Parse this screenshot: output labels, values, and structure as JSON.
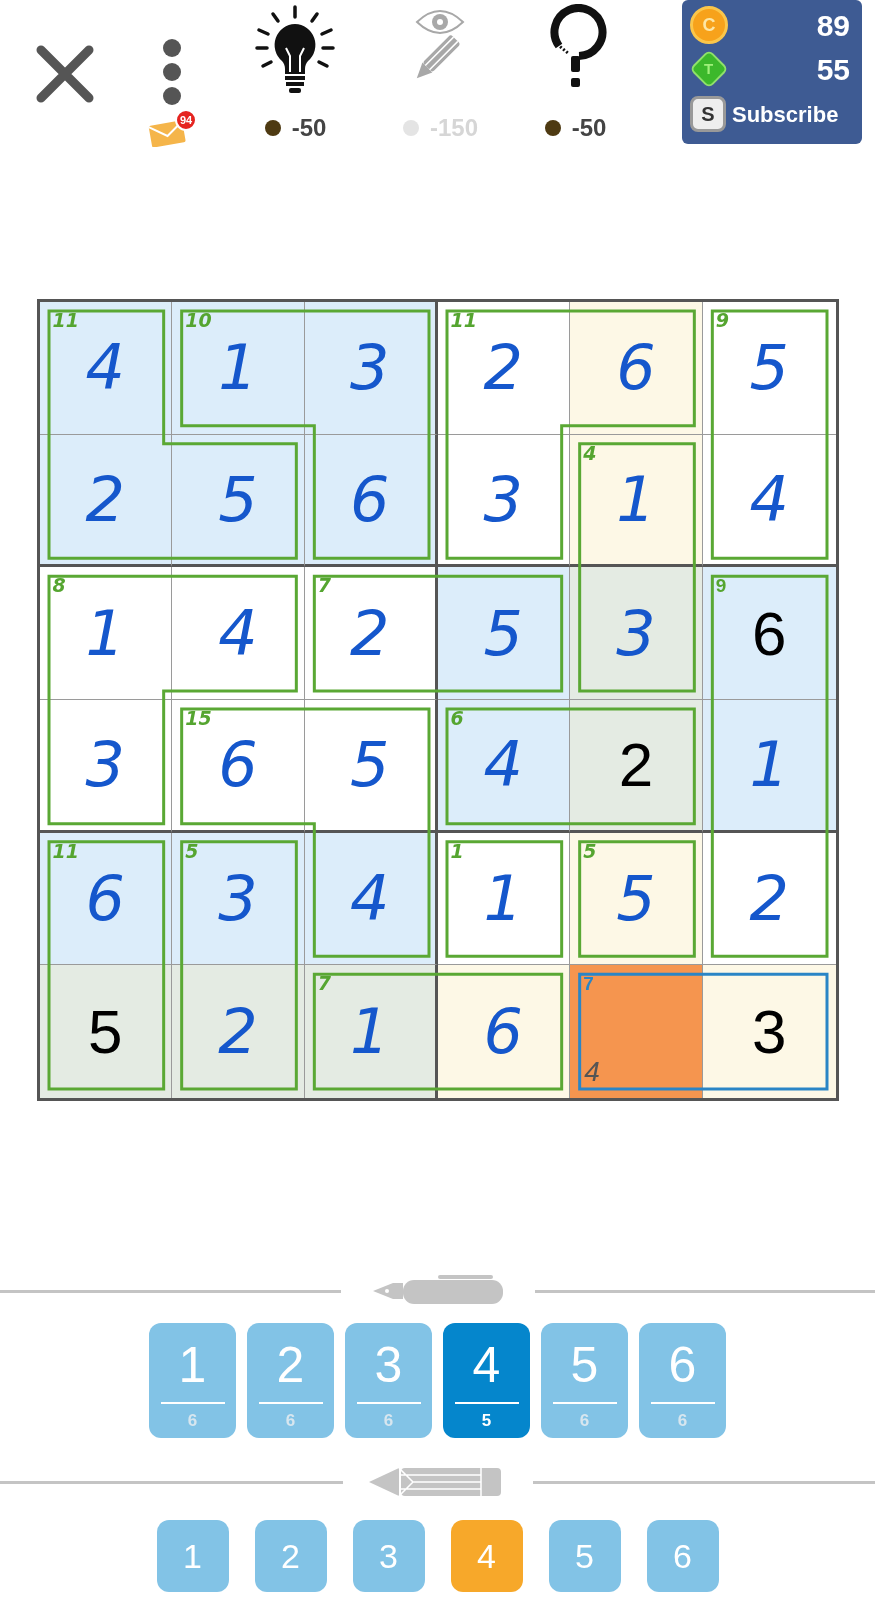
{
  "header": {
    "close": true,
    "menu": {
      "mail_badge": "94"
    }
  },
  "tools": [
    {
      "kind": "hint",
      "cost": "-50",
      "disabled": false
    },
    {
      "kind": "reveal",
      "cost": "-150",
      "disabled": true
    },
    {
      "kind": "check",
      "cost": "-50",
      "disabled": false
    }
  ],
  "wallet": {
    "coins": {
      "letter": "C",
      "amount": "89"
    },
    "tokens": {
      "letter": "T",
      "amount": "55"
    },
    "subscribe": {
      "letter": "S",
      "label": "Subscribe"
    }
  },
  "grid": {
    "rows": [
      {
        "cells": [
          {
            "value": "4",
            "given": false,
            "color": "#dcedfa",
            "cage_sum": "11",
            "join_right": false,
            "join_down": true,
            "selected": false
          },
          {
            "value": "1",
            "given": false,
            "color": "#dcedfa",
            "cage_sum": "10",
            "join_right": true,
            "join_down": false,
            "selected": false
          },
          {
            "value": "3",
            "given": false,
            "color": "#dcedfa",
            "join_right": false,
            "join_down": true,
            "selected": false
          },
          {
            "value": "2",
            "given": false,
            "color": "#ffffff",
            "cage_sum": "11",
            "join_right": true,
            "join_down": true,
            "selected": false
          },
          {
            "value": "6",
            "given": false,
            "color": "#fdf8e6",
            "join_right": false,
            "join_down": false,
            "selected": false
          },
          {
            "value": "5",
            "given": false,
            "color": "#ffffff",
            "cage_sum": "9",
            "join_right": false,
            "join_down": true,
            "selected": false
          }
        ]
      },
      {
        "cells": [
          {
            "value": "2",
            "given": false,
            "color": "#dcedfa",
            "join_right": true,
            "join_down": false,
            "selected": false
          },
          {
            "value": "5",
            "given": false,
            "color": "#dcedfa",
            "join_right": false,
            "join_down": false,
            "selected": false
          },
          {
            "value": "6",
            "given": false,
            "color": "#dcedfa",
            "join_right": false,
            "join_down": false,
            "selected": false
          },
          {
            "value": "3",
            "given": false,
            "color": "#ffffff",
            "join_right": false,
            "join_down": false,
            "selected": false
          },
          {
            "value": "1",
            "given": false,
            "color": "#fdf8e6",
            "cage_sum": "4",
            "join_right": false,
            "join_down": true,
            "selected": false
          },
          {
            "value": "4",
            "given": false,
            "color": "#ffffff",
            "join_right": false,
            "join_down": false,
            "selected": false
          }
        ]
      },
      {
        "cells": [
          {
            "value": "1",
            "given": false,
            "color": "#ffffff",
            "cage_sum": "8",
            "join_right": true,
            "join_down": true,
            "selected": false
          },
          {
            "value": "4",
            "given": false,
            "color": "#ffffff",
            "join_right": false,
            "join_down": false,
            "selected": false
          },
          {
            "value": "2",
            "given": false,
            "color": "#ffffff",
            "cage_sum": "7",
            "join_right": true,
            "join_down": false,
            "selected": false
          },
          {
            "value": "5",
            "given": false,
            "color": "#dcedfa",
            "join_right": false,
            "join_down": false,
            "selected": false
          },
          {
            "value": "3",
            "given": false,
            "color": "#e4ebe3",
            "join_right": false,
            "join_down": false,
            "selected": false
          },
          {
            "value": "6",
            "given": true,
            "color": "#dcedfa",
            "cage_sum": "9",
            "join_right": false,
            "join_down": true,
            "selected": false
          }
        ]
      },
      {
        "cells": [
          {
            "value": "3",
            "given": false,
            "color": "#ffffff",
            "join_right": false,
            "join_down": false,
            "selected": false
          },
          {
            "value": "6",
            "given": false,
            "color": "#ffffff",
            "cage_sum": "15",
            "join_right": true,
            "join_down": false,
            "selected": false
          },
          {
            "value": "5",
            "given": false,
            "color": "#ffffff",
            "join_right": false,
            "join_down": true,
            "selected": false
          },
          {
            "value": "4",
            "given": false,
            "color": "#dcedfa",
            "cage_sum": "6",
            "join_right": true,
            "join_down": false,
            "selected": false
          },
          {
            "value": "2",
            "given": true,
            "color": "#e4ebe3",
            "join_right": false,
            "join_down": false,
            "selected": false
          },
          {
            "value": "1",
            "given": false,
            "color": "#dcedfa",
            "join_right": false,
            "join_down": true,
            "selected": false
          }
        ]
      },
      {
        "cells": [
          {
            "value": "6",
            "given": false,
            "color": "#dcedfa",
            "cage_sum": "11",
            "join_right": false,
            "join_down": true,
            "selected": false
          },
          {
            "value": "3",
            "given": false,
            "color": "#dcedfa",
            "cage_sum": "5",
            "join_right": false,
            "join_down": true,
            "selected": false
          },
          {
            "value": "4",
            "given": false,
            "color": "#dcedfa",
            "join_right": false,
            "join_down": false,
            "selected": false
          },
          {
            "value": "1",
            "given": false,
            "color": "#ffffff",
            "cage_sum": "1",
            "join_right": false,
            "join_down": false,
            "selected": false
          },
          {
            "value": "5",
            "given": false,
            "color": "#fdf8e6",
            "cage_sum": "5",
            "join_right": false,
            "join_down": false,
            "selected": false
          },
          {
            "value": "2",
            "given": false,
            "color": "#ffffff",
            "join_right": false,
            "join_down": false,
            "selected": false
          }
        ]
      },
      {
        "cells": [
          {
            "value": "5",
            "given": true,
            "color": "#e4ebe3",
            "join_right": false,
            "join_down": false,
            "selected": false
          },
          {
            "value": "2",
            "given": false,
            "color": "#e4ebe3",
            "join_right": false,
            "join_down": false,
            "selected": false
          },
          {
            "value": "1",
            "given": false,
            "color": "#e4ebe3",
            "cage_sum": "7",
            "join_right": true,
            "join_down": false,
            "selected": false
          },
          {
            "value": "6",
            "given": false,
            "color": "#fdf8e6",
            "join_right": false,
            "join_down": false,
            "selected": false
          },
          {
            "notes": "4",
            "cage_sum": "7",
            "join_right": true,
            "join_down": false,
            "selected": true
          },
          {
            "value": "3",
            "given": true,
            "color": "#fdf8e6",
            "join_right": false,
            "join_down": false,
            "selected": false
          }
        ]
      }
    ]
  },
  "pen_keypad": {
    "keys": [
      {
        "digit": "1",
        "remaining": "6",
        "selected": false
      },
      {
        "digit": "2",
        "remaining": "6",
        "selected": false
      },
      {
        "digit": "3",
        "remaining": "6",
        "selected": false
      },
      {
        "digit": "4",
        "remaining": "5",
        "selected": true
      },
      {
        "digit": "5",
        "remaining": "6",
        "selected": false
      },
      {
        "digit": "6",
        "remaining": "6",
        "selected": false
      }
    ]
  },
  "pencil_keypad": {
    "keys": [
      {
        "digit": "1",
        "selected": false
      },
      {
        "digit": "2",
        "selected": false
      },
      {
        "digit": "3",
        "selected": false
      },
      {
        "digit": "4",
        "selected": true
      },
      {
        "digit": "5",
        "selected": false
      },
      {
        "digit": "6",
        "selected": false
      }
    ]
  }
}
